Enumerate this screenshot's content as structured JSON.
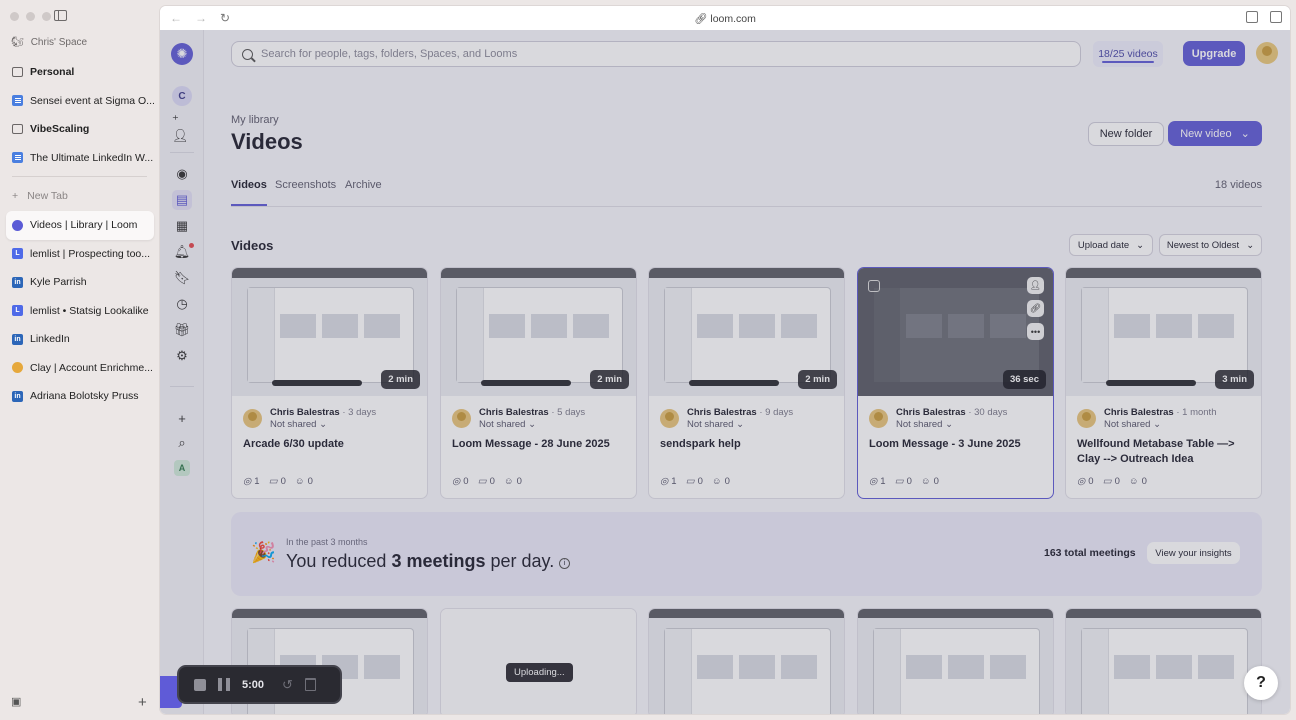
{
  "browser": {
    "space_label": "Chris' Space",
    "pinned": [
      {
        "label": "Personal",
        "type": "folder"
      },
      {
        "label": "Sensei event at Sigma O...",
        "type": "doc"
      },
      {
        "label": "VibeScaling",
        "type": "folder"
      },
      {
        "label": "The Ultimate LinkedIn W...",
        "type": "doc"
      }
    ],
    "new_tab": "New Tab",
    "tabs": [
      {
        "label": "Videos | Library | Loom",
        "icon": "loom-icon",
        "active": true
      },
      {
        "label": "lemlist | Prospecting too...",
        "icon": "lemlist-icon"
      },
      {
        "label": "Kyle Parrish",
        "icon": "linkedin-icon"
      },
      {
        "label": "lemlist • Statsig Lookalike",
        "icon": "lemlist-icon"
      },
      {
        "label": "LinkedIn",
        "icon": "linkedin-icon"
      },
      {
        "label": "Clay | Account Enrichme...",
        "icon": "clay-icon"
      },
      {
        "label": "Adriana Bolotsky Pruss",
        "icon": "linkedin-icon"
      }
    ],
    "url": "loom.com"
  },
  "app": {
    "search_placeholder": "Search for people, tags, folders, Spaces, and Looms",
    "quota": "18/25 videos",
    "quota_fraction": 0.72,
    "upgrade": "Upgrade",
    "rail_avatar": "C",
    "rail_workspace": "A",
    "breadcrumb": "My library",
    "title": "Videos",
    "new_folder": "New folder",
    "new_video": "New video",
    "tabs": [
      "Videos",
      "Screenshots",
      "Archive"
    ],
    "video_count": "18 videos",
    "section_title": "Videos",
    "sort_field": "Upload date",
    "sort_order": "Newest to Oldest",
    "videos": [
      {
        "author": "Chris Balestras",
        "age": "· 3 days",
        "sharing": "Not shared ⌄",
        "title": "Arcade 6/30 update",
        "duration": "2 min",
        "views": "1",
        "comments": "0",
        "reactions": "0"
      },
      {
        "author": "Chris Balestras",
        "age": "· 5 days",
        "sharing": "Not shared ⌄",
        "title": "Loom Message - 28 June 2025",
        "duration": "2 min",
        "views": "0",
        "comments": "0",
        "reactions": "0"
      },
      {
        "author": "Chris Balestras",
        "age": "· 9 days",
        "sharing": "Not shared ⌄",
        "title": "sendspark help",
        "duration": "2 min",
        "views": "1",
        "comments": "0",
        "reactions": "0"
      },
      {
        "author": "Chris Balestras",
        "age": "· 30 days",
        "sharing": "Not shared ⌄",
        "title": "Loom Message - 3 June 2025",
        "duration": "36 sec",
        "views": "1",
        "comments": "0",
        "reactions": "0"
      },
      {
        "author": "Chris Balestras",
        "age": "· 1 month",
        "sharing": "Not shared ⌄",
        "title": "Wellfound Metabase Table —> Clay --> Outreach Idea",
        "duration": "3 min",
        "views": "0",
        "comments": "0",
        "reactions": "0"
      }
    ],
    "insight": {
      "sub": "In the past 3 months",
      "prefix": "You reduced ",
      "bold": "3 meetings",
      "suffix": " per day.",
      "total": "163 total meetings",
      "button": "View your insights"
    },
    "uploading": "Uploading...",
    "help": "?",
    "recording": {
      "time": "5:00"
    }
  }
}
